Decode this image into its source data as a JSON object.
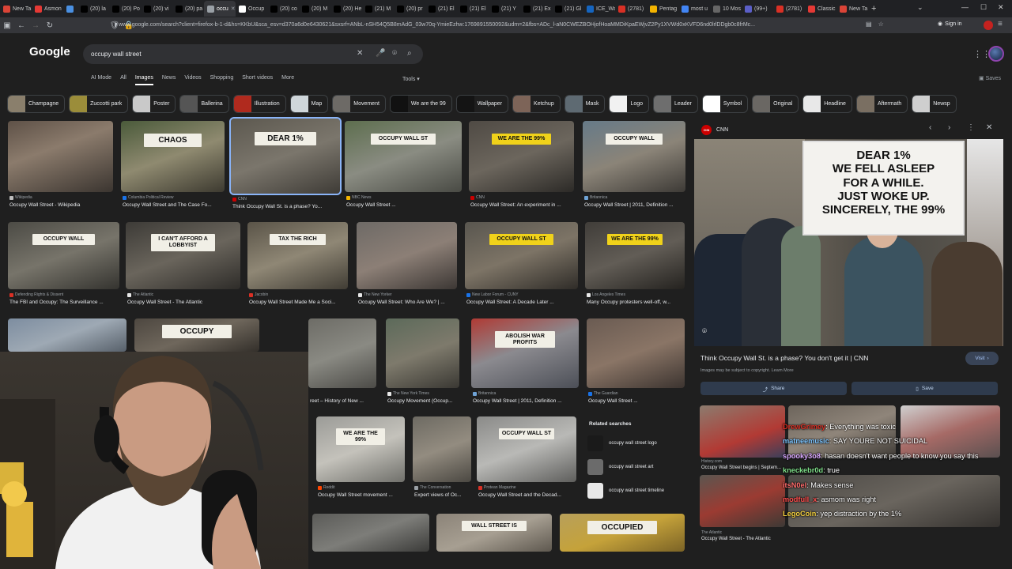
{
  "browser": {
    "tabs": [
      {
        "label": "New Ta",
        "color": "#db4437",
        "active": false
      },
      {
        "label": "Asmon",
        "color": "#e53935",
        "active": false
      },
      {
        "label": "",
        "color": "#4a90e2",
        "active": false
      },
      {
        "label": "(20) la",
        "color": "#000000",
        "active": false
      },
      {
        "label": "(20) Po",
        "color": "#000000",
        "active": false
      },
      {
        "label": "(20) vi",
        "color": "#000000",
        "active": false
      },
      {
        "label": "(20) pa",
        "color": "#000000",
        "active": false
      },
      {
        "label": "occu",
        "color": "#9aa0a6",
        "active": true
      },
      {
        "label": "Occup",
        "color": "#ffffff",
        "active": false
      },
      {
        "label": "(20) co",
        "color": "#000000",
        "active": false
      },
      {
        "label": "(20) M",
        "color": "#000000",
        "active": false
      },
      {
        "label": "(20) He",
        "color": "#000000",
        "active": false
      },
      {
        "label": "(21) M",
        "color": "#000000",
        "active": false
      },
      {
        "label": "(20) pr",
        "color": "#000000",
        "active": false
      },
      {
        "label": "(21) El",
        "color": "#000000",
        "active": false
      },
      {
        "label": "(21) El",
        "color": "#000000",
        "active": false
      },
      {
        "label": "(21) Y",
        "color": "#000000",
        "active": false
      },
      {
        "label": "(21) Ex",
        "color": "#000000",
        "active": false
      },
      {
        "label": "(21) Gl",
        "color": "#000000",
        "active": false
      },
      {
        "label": "ICE_Wa",
        "color": "#1565c0",
        "active": false
      },
      {
        "label": "(2781)",
        "color": "#d93025",
        "active": false
      },
      {
        "label": "Pentag",
        "color": "#f4b400",
        "active": false
      },
      {
        "label": "most u",
        "color": "#4285f4",
        "active": false
      },
      {
        "label": "10 Mos",
        "color": "#666666",
        "active": false
      },
      {
        "label": "(99+)",
        "color": "#5b5fc7",
        "active": false
      },
      {
        "label": "(2781)",
        "color": "#d93025",
        "active": false
      },
      {
        "label": "Classic",
        "color": "#e53935",
        "active": false
      },
      {
        "label": "New Ta",
        "color": "#db4437",
        "active": false
      }
    ],
    "url": "www.google.com/search?client=firefox-b-1-d&hs=KKbU&sca_esv=d370a6d0e6430621&sxsrf=ANbL-nSH54Q5B8mAdG_03w70q-YmieEzhw:1769891550092&udm=2&fbs=ADc_l-aN0CWEZBOHjofHoaMMDiKpaEWjvZ2Py1XVWd0xKVFD6nd0lrlDDgb0c8frMc...",
    "signin_label": "Sign in"
  },
  "google": {
    "logo": "Google",
    "query": "occupy wall street",
    "tabs": [
      "AI Mode",
      "All",
      "Images",
      "News",
      "Videos",
      "Shopping",
      "Short videos",
      "More"
    ],
    "active_tab": "Images",
    "tools_label": "Tools",
    "saves_label": "Saves",
    "chips": [
      {
        "label": "Champagne",
        "color": "#8a7f6c"
      },
      {
        "label": "Zuccotti park",
        "color": "#9b8d3a"
      },
      {
        "label": "Poster",
        "color": "#c9c9c9"
      },
      {
        "label": "Ballerina",
        "color": "#555555"
      },
      {
        "label": "Illustration",
        "color": "#b02a1e"
      },
      {
        "label": "Map",
        "color": "#cfd6da"
      },
      {
        "label": "Movement",
        "color": "#6d6a66"
      },
      {
        "label": "We are the 99",
        "color": "#111111"
      },
      {
        "label": "Wallpaper",
        "color": "#141414"
      },
      {
        "label": "Ketchup",
        "color": "#7d6458"
      },
      {
        "label": "Mask",
        "color": "#5e6a72"
      },
      {
        "label": "Logo",
        "color": "#f1f1f1"
      },
      {
        "label": "Leader",
        "color": "#6e6e6e"
      },
      {
        "label": "Symbol",
        "color": "#ffffff"
      },
      {
        "label": "Original",
        "color": "#6a6763"
      },
      {
        "label": "Headline",
        "color": "#e8e8e8"
      },
      {
        "label": "Aftermath",
        "color": "#7a6f62"
      },
      {
        "label": "Newsp",
        "color": "#cfcfcf"
      }
    ],
    "results": [
      {
        "source": "Wikipedia",
        "title": "Occupy Wall Street - Wikipedia",
        "src_color": "#bdbdbd",
        "bg": "linear-gradient(160deg,#5e5147 0%,#8b7b6c 40%,#3b3530 100%)",
        "sign": ""
      },
      {
        "source": "Columbia Political Review",
        "title": "Occupy Wall Street and The Case Fo...",
        "src_color": "#1a73e8",
        "bg": "linear-gradient(160deg,#4a5a3a 0%,#8f8a70 50%,#3d3a30 100%)",
        "sign": "CHAOS"
      },
      {
        "source": "CNN",
        "title": "Think Occupy Wall St. is a phase? Yo...",
        "src_color": "#cc0000",
        "bg": "linear-gradient(160deg,#5c584f 0%,#7b766c 50%,#3e3b36 100%)",
        "sign": "DEAR 1%"
      },
      {
        "source": "NBC News",
        "title": "Occupy Wall Street ...",
        "src_color": "#f4b400",
        "bg": "linear-gradient(160deg,#5d6e4e 0%,#8a8c82 50%,#494a44 100%)",
        "sign": "OCCUPY WALL ST"
      },
      {
        "source": "CNN",
        "title": "Occupy Wall Street: An experiment in ...",
        "src_color": "#cc0000",
        "bg": "linear-gradient(160deg,#4f4a44 0%,#6c665d 50%,#2c2a27 100%)",
        "sign": "WE ARE THE 99%"
      },
      {
        "source": "Britannica",
        "title": "Occupy Wall Street | 2011, Definition ...",
        "src_color": "#6fa3d6",
        "bg": "linear-gradient(160deg,#667a88 0%,#8b8478 50%,#3d3a36 100%)",
        "sign": "OCCUPY WALL"
      },
      {
        "source": "Defending Rights & Dissent",
        "title": "The FBI and Occupy: The Surveillance ...",
        "src_color": "#d93025",
        "bg": "linear-gradient(160deg,#4c4b45 0%,#77746a 50%,#34332f 100%)",
        "sign": "OCCUPY WALL"
      },
      {
        "source": "The Atlantic",
        "title": "Occupy Wall Street - The Atlantic",
        "src_color": "#e8e8e8",
        "bg": "linear-gradient(160deg,#3d3b37 0%,#6a655c 50%,#2e2c29 100%)",
        "sign": "I CAN'T AFFORD A LOBBYIST"
      },
      {
        "source": "Jacobin",
        "title": "Occupy Wall Street Made Me a Soci...",
        "src_color": "#d93025",
        "bg": "linear-gradient(160deg,#5a5448 0%,#8f8775 50%,#403c34 100%)",
        "sign": "TAX THE RICH"
      },
      {
        "source": "The New Yorker",
        "title": "Occupy Wall Street: Who Are We? | ...",
        "src_color": "#e8e8e8",
        "bg": "linear-gradient(160deg,#6e6a66 0%,#8c7f76 50%,#3c3734 100%)",
        "sign": ""
      },
      {
        "source": "New Labor Forum - CUNY",
        "title": "Occupy Wall Street: A Decade Later ...",
        "src_color": "#1a73e8",
        "bg": "linear-gradient(160deg,#59564f 0%,#7d7466 50%,#2f2c28 100%)",
        "sign": "OCCUPY WALL ST"
      },
      {
        "source": "Los Angeles Times",
        "title": "Many Occupy protesters well-off, w...",
        "src_color": "#e8e8e8",
        "bg": "linear-gradient(160deg,#403d39 0%,#625d56 50%,#24221f 100%)",
        "sign": "WE ARE THE 99%"
      },
      {
        "source": "",
        "title": "",
        "src_color": "#9aa0a6",
        "bg": "linear-gradient(160deg,#7d8da0 0%,#9ea9b4 50%,#57606a 100%)",
        "sign": ""
      },
      {
        "source": "",
        "title": "",
        "src_color": "#9aa0a6",
        "bg": "linear-gradient(160deg,#4d4740 0%,#6f675c 50%,#332f2a 100%)",
        "sign": "OCCUPY"
      },
      {
        "source": "",
        "title": "reet – History of New ...",
        "src_color": "#9aa0a6",
        "bg": "linear-gradient(160deg,#6d6c66 0%,#8a8a83 50%,#4c4b47 100%)",
        "sign": ""
      },
      {
        "source": "The New York Times",
        "title": "Occupy Movement (Occup...",
        "src_color": "#e8e8e8",
        "bg": "linear-gradient(160deg,#5c6a5a 0%,#7e7a6c 50%,#3a3833 100%)",
        "sign": ""
      },
      {
        "source": "Britannica",
        "title": "Occupy Wall Street | 2011, Definition ...",
        "src_color": "#6fa3d6",
        "bg": "linear-gradient(160deg,#b03a34 0%,#8b8a8f 45%,#4c4f57 100%)",
        "sign": "ABOLISH WAR PROFITS"
      },
      {
        "source": "The Guardian",
        "title": "Occupy Wall Street ...",
        "src_color": "#1a73e8",
        "bg": "linear-gradient(160deg,#6a5b52 0%,#8a7566 50%,#3c3430 100%)",
        "sign": ""
      },
      {
        "source": "Reddit",
        "title": "Occupy Wall Street movement ...",
        "src_color": "#ff4500",
        "bg": "linear-gradient(160deg,#9b9b97 0%,#c4c2bb 50%,#70706b 100%)",
        "sign": "WE ARE THE 99%"
      },
      {
        "source": "The Conversation",
        "title": "Expert views of Oc...",
        "src_color": "#9aa0a6",
        "bg": "linear-gradient(160deg,#6d6a62 0%,#938c80 50%,#4b4842 100%)",
        "sign": ""
      },
      {
        "source": "Protean Magazine",
        "title": "Occupy Wall Street and the Decad...",
        "src_color": "#d93025",
        "bg": "linear-gradient(160deg,#8a8a88 0%,#b9b9b6 50%,#5e5e5c 100%)",
        "sign": "OCCUPY WALL ST"
      },
      {
        "source": "",
        "title": "",
        "src_color": "#9aa0a6",
        "bg": "linear-gradient(160deg,#5b5b58 0%,#7d7d79 50%,#3b3b39 100%)",
        "sign": ""
      },
      {
        "source": "",
        "title": "",
        "src_color": "#9aa0a6",
        "bg": "linear-gradient(160deg,#8b8378 0%,#a79f92 50%,#5e584f 100%)",
        "sign": "WALL STREET IS"
      },
      {
        "source": "",
        "title": "",
        "src_color": "#9aa0a6",
        "bg": "linear-gradient(160deg,#b8a05a 0%,#c5a23a 50%,#7b6326 100%)",
        "sign": "OCCUPIED"
      }
    ],
    "related_title": "Related searches",
    "related": [
      "occupy wall street logo",
      "occupy wall street art",
      "occupy wall street timeline"
    ]
  },
  "panel": {
    "source": "CNN",
    "image_sign": "DEAR 1%\nWE FELL ASLEEP\nFOR A WHILE.\nJUST WOKE UP.\nSINCERELY, THE 99%",
    "title": "Think Occupy Wall St. is a phase? You don't get it | CNN",
    "copyright": "Images may be subject to copyright. Learn More",
    "visit_label": "Visit",
    "share_label": "Share",
    "save_label": "Save",
    "more_results": [
      {
        "source": "History.com",
        "title": "Occupy Wall Street begins | Septem..."
      },
      {
        "source": "The Atlantic",
        "title": "Occupy Wall Street - The Atlantic"
      }
    ]
  },
  "chat": [
    {
      "user": "DrewGrimey",
      "color": "#d93025",
      "message": "Everything was toxic"
    },
    {
      "user": "matneemusic",
      "color": "#7cc4ff",
      "message": "SAY YOURE NOT SUICIDAL"
    },
    {
      "user": "spooky3o8",
      "color": "#d7a7ff",
      "message": "hasan doesn't want people to know you say this"
    },
    {
      "user": "kneckebr0d",
      "color": "#7fe08a",
      "message": "true"
    },
    {
      "user": "itsN0el",
      "color": "#ff6b6b",
      "message": "Makes sense"
    },
    {
      "user": "modfull_x",
      "color": "#ff4d4d",
      "message": "asmom was right"
    },
    {
      "user": "LegoCoin",
      "color": "#f4d03f",
      "message": "yep distraction by the 1%"
    }
  ]
}
